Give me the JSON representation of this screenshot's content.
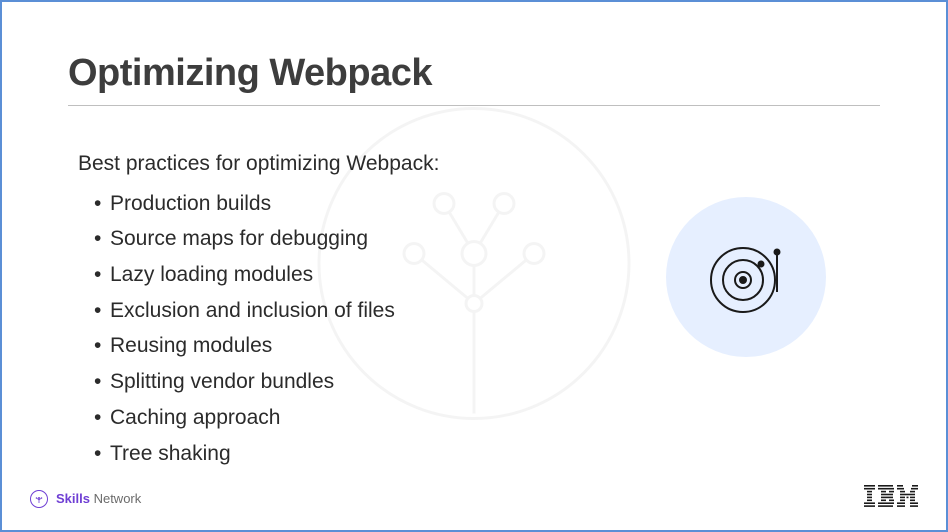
{
  "title": "Optimizing Webpack",
  "intro": "Best practices for optimizing Webpack:",
  "bullets": [
    "Production builds",
    "Source maps for debugging",
    "Lazy loading modules",
    "Exclusion and inclusion of files",
    "Reusing modules",
    "Splitting vendor bundles",
    "Caching approach",
    "Tree shaking"
  ],
  "footer": {
    "skills_bold": "Skills",
    "skills_light": " Network",
    "logo": "IBM"
  }
}
